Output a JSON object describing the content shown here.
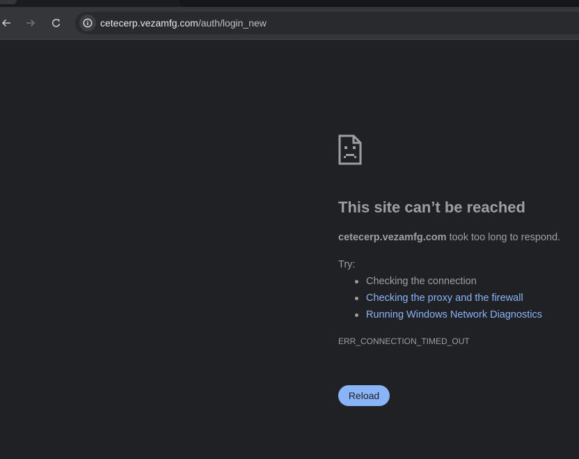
{
  "browser": {
    "address_bar": {
      "url_host": "cetecerp.vezamfg.com",
      "url_path": "/auth/login_new"
    },
    "nav_icons": [
      "back-arrow-icon",
      "forward-arrow-icon",
      "reload-icon",
      "site-info-icon"
    ]
  },
  "error_page": {
    "icon": "sad-page-icon",
    "title": "This site can’t be reached",
    "summary_host": "cetecerp.vezamfg.com",
    "summary_text": " took too long to respond.",
    "try_label": "Try:",
    "suggestions": [
      "Checking the connection",
      "Checking the proxy and the firewall",
      "Running Windows Network Diagnostics"
    ],
    "error_code": "ERR_CONNECTION_TIMED_OUT",
    "reload_label": "Reload"
  },
  "colors": {
    "page_background": "#202124",
    "text": "#9aa0a6",
    "link": "#8ab4f8",
    "button": "#8ab4f8"
  }
}
